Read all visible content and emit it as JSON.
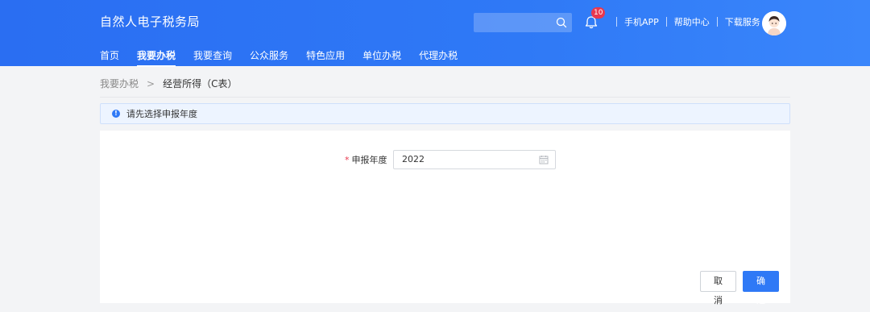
{
  "header": {
    "app_title": "自然人电子税务局",
    "search_placeholder": "",
    "notification_count": "10",
    "links": [
      "手机APP",
      "帮助中心",
      "下载服务"
    ]
  },
  "nav": {
    "items": [
      "首页",
      "我要办税",
      "我要查询",
      "公众服务",
      "特色应用",
      "单位办税",
      "代理办税"
    ],
    "active_index": 1
  },
  "breadcrumb": {
    "parent": "我要办税",
    "separator": ">",
    "current": "经营所得（C表）"
  },
  "notice": {
    "text": "请先选择申报年度"
  },
  "form": {
    "required_mark": "*",
    "year_label": "申报年度",
    "year_value": "2022"
  },
  "actions": {
    "cancel_label": "取消",
    "confirm_label": "确定"
  },
  "colors": {
    "header_blue": "#2f79f6",
    "badge_red": "#e8384f",
    "notice_bg": "#edf4ff"
  },
  "icons": [
    "search-icon",
    "bell-icon",
    "avatar",
    "info-icon",
    "calendar-icon"
  ]
}
